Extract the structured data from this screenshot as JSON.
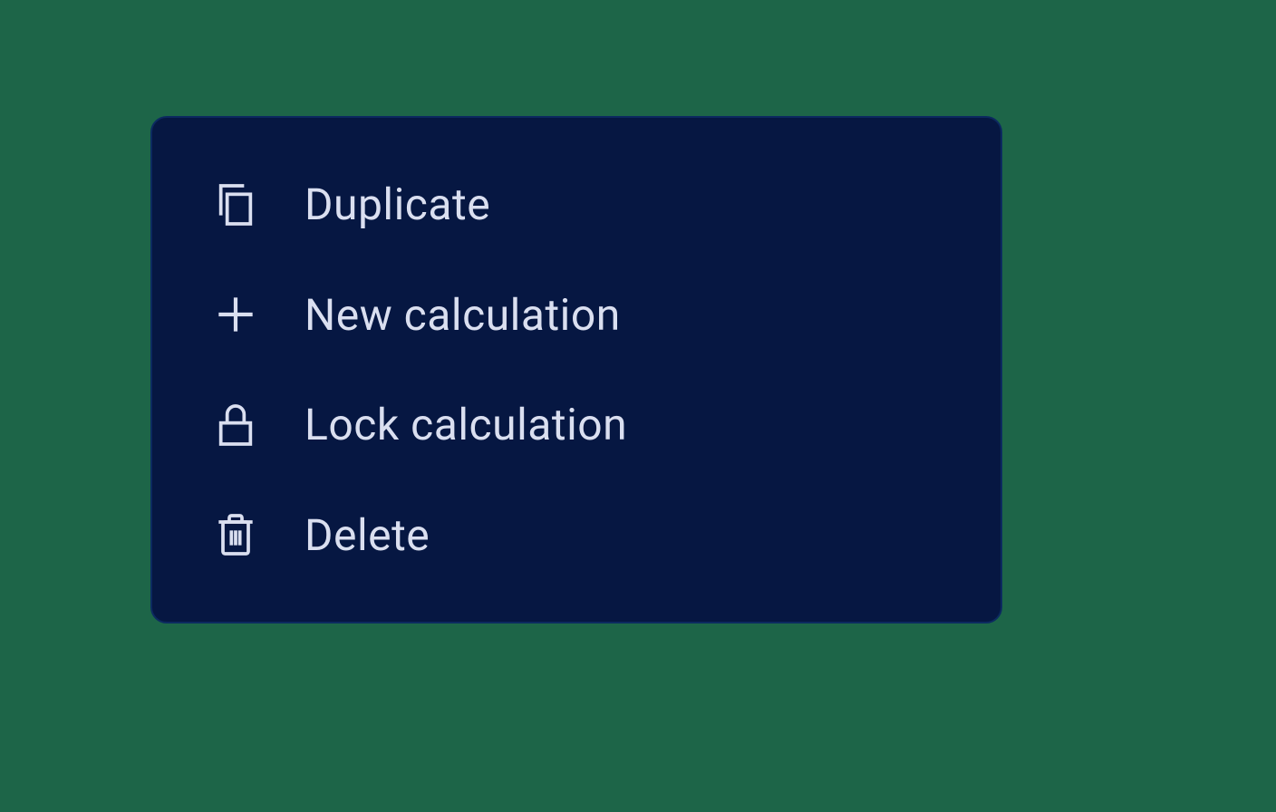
{
  "menu": {
    "items": [
      {
        "label": "Duplicate"
      },
      {
        "label": "New calculation"
      },
      {
        "label": "Lock calculation"
      },
      {
        "label": "Delete"
      }
    ]
  },
  "colors": {
    "background": "#1d6548",
    "panel": "#061742",
    "panel_border": "#0c2a60",
    "foreground": "#dadff0"
  }
}
